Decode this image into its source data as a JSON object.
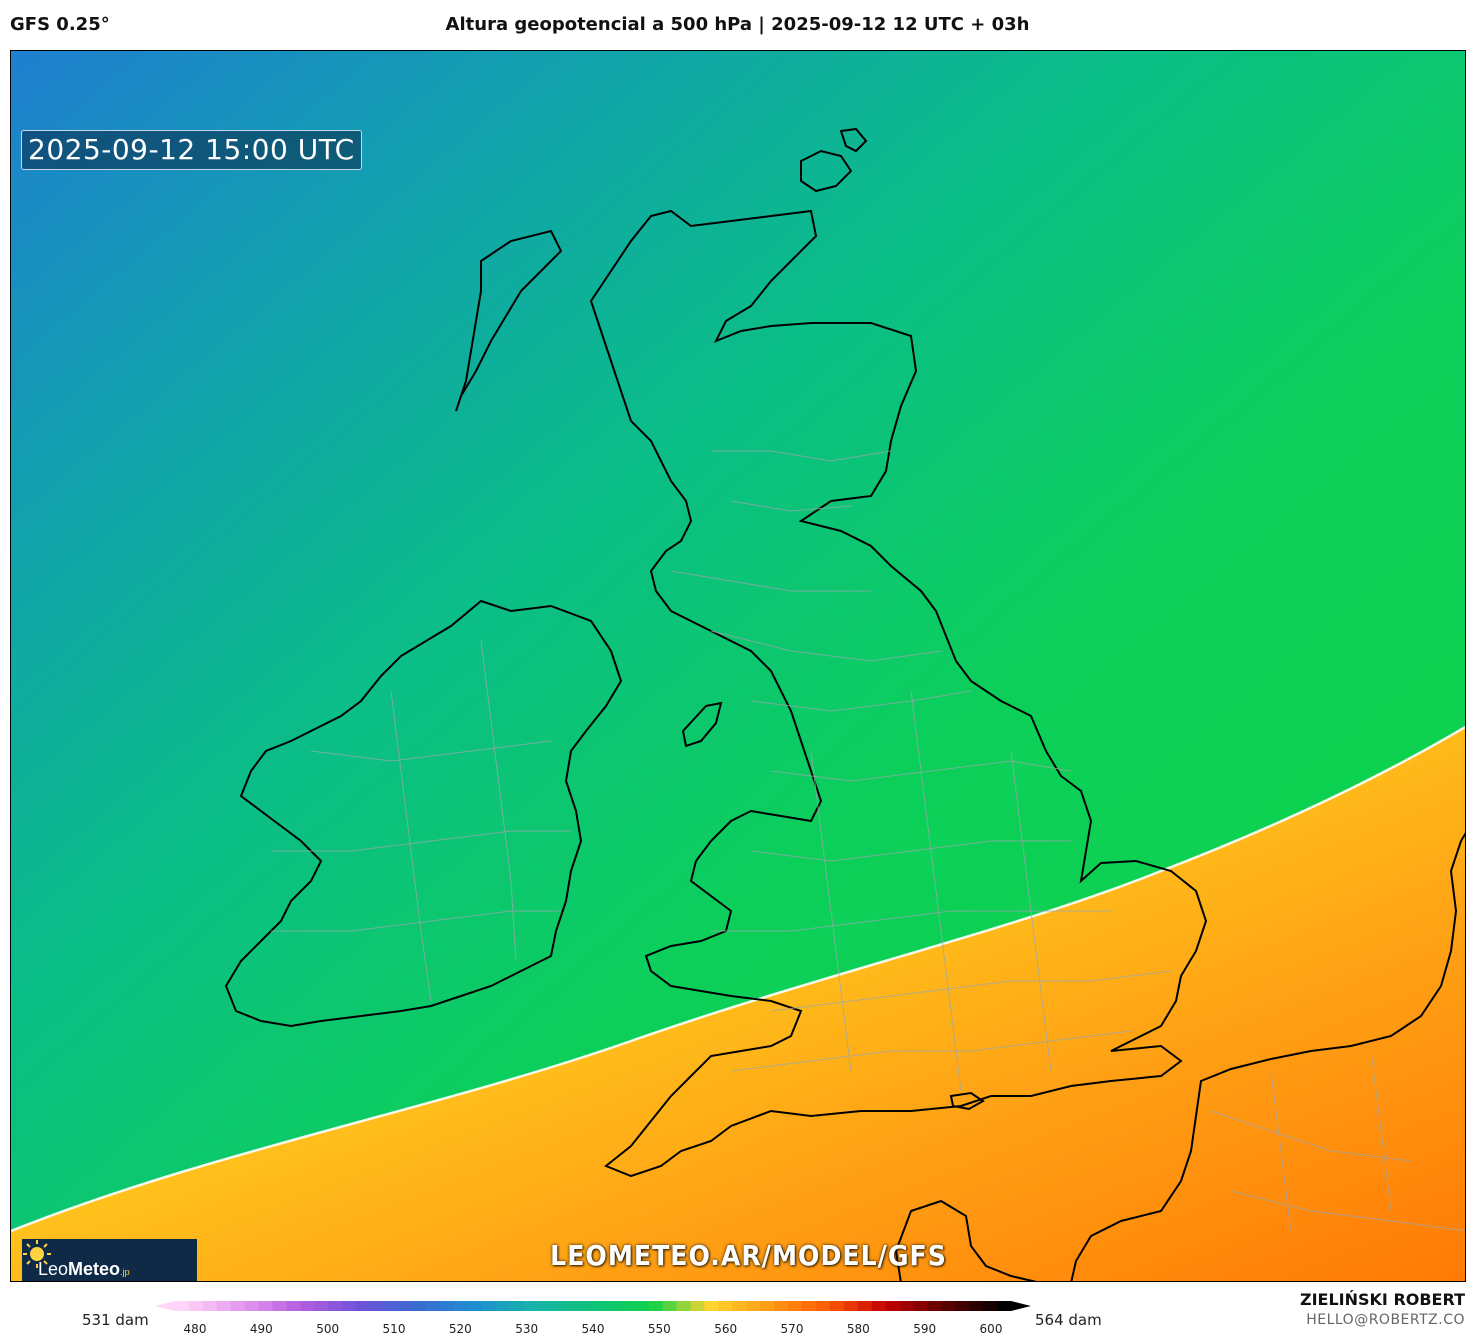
{
  "header": {
    "model": "GFS 0.25°",
    "title": "Altura geopotencial a 500 hPa | 2025-09-12 12 UTC + 03h"
  },
  "map": {
    "valid_time": "2025-09-12 15:00 UTC",
    "watermark": "LEOMETEO.AR/MODEL/GFS",
    "logo": {
      "name_part1": "Leo",
      "name_part2": "Meteo",
      "suffix": ".jp",
      "icon": "sun-icon"
    },
    "field": "500 hPa geopotential height",
    "contour_highlight_dam": 552
  },
  "legend": {
    "min_label": "531 dam",
    "max_label": "564 dam",
    "ticks": [
      "480",
      "490",
      "500",
      "510",
      "520",
      "530",
      "540",
      "550",
      "560",
      "570",
      "580",
      "590",
      "600"
    ],
    "color_stops": [
      "#ffd6f7",
      "#e59af0",
      "#b65ee0",
      "#6f52d8",
      "#3a6bd0",
      "#1f8fd1",
      "#17b4a8",
      "#0fc27a",
      "#11d24a",
      "#ffd52e",
      "#ff9b16",
      "#ff5a00",
      "#c40000",
      "#5c0000",
      "#000000"
    ]
  },
  "credits": {
    "author": "ZIELIŃSKI ROBERT",
    "contact": "HELLO@ROBERTZ.CO"
  }
}
